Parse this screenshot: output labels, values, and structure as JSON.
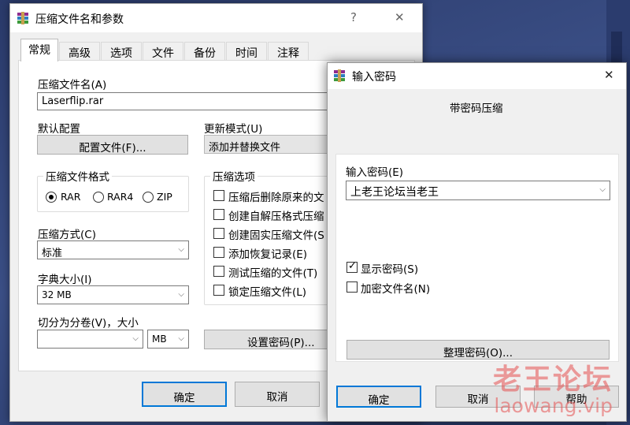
{
  "main_dialog": {
    "title": "压缩文件名和参数",
    "help_glyph": "?",
    "close_glyph": "✕",
    "tabs": [
      "常规",
      "高级",
      "选项",
      "文件",
      "备份",
      "时间",
      "注释"
    ],
    "archive_name_label": "压缩文件名(A)",
    "archive_name_value": "Laserflip.rar",
    "default_profile_label": "默认配置",
    "profiles_button": "配置文件(F)...",
    "update_mode_label": "更新模式(U)",
    "update_mode_value": "添加并替换文件",
    "archive_format_label": "压缩文件格式",
    "formats": [
      "RAR",
      "RAR4",
      "ZIP"
    ],
    "selected_format": "RAR",
    "archive_options_label": "压缩选项",
    "options": [
      {
        "label": "压缩后删除原来的文",
        "checked": false
      },
      {
        "label": "创建自解压格式压缩",
        "checked": false
      },
      {
        "label": "创建固实压缩文件(S",
        "checked": false
      },
      {
        "label": "添加恢复记录(E)",
        "checked": false
      },
      {
        "label": "测试压缩的文件(T)",
        "checked": false
      },
      {
        "label": "锁定压缩文件(L)",
        "checked": false
      }
    ],
    "compression_method_label": "压缩方式(C)",
    "compression_method_value": "标准",
    "dictionary_size_label": "字典大小(I)",
    "dictionary_size_value": "32 MB",
    "split_label": "切分为分卷(V)，大小",
    "split_value": "",
    "split_unit": "MB",
    "set_password_button": "设置密码(P)...",
    "ok_button": "确定",
    "cancel_button": "取消"
  },
  "password_dialog": {
    "title": "输入密码",
    "close_glyph": "✕",
    "heading": "带密码压缩",
    "password_label": "输入密码(E)",
    "password_value": "上老王论坛当老王",
    "show_password_label": "显示密码(S)",
    "show_password_checked": true,
    "encrypt_names_label": "加密文件名(N)",
    "encrypt_names_checked": false,
    "organize_button": "整理密码(O)...",
    "ok_button": "确定",
    "cancel_button": "取消",
    "help_button": "帮助"
  },
  "watermark": {
    "title": "老王论坛",
    "url": "laowang.vip"
  },
  "colors": {
    "focus_blue": "#0078d7",
    "dialog_bg": "#f0f0f0",
    "watermark": "#e65050"
  }
}
